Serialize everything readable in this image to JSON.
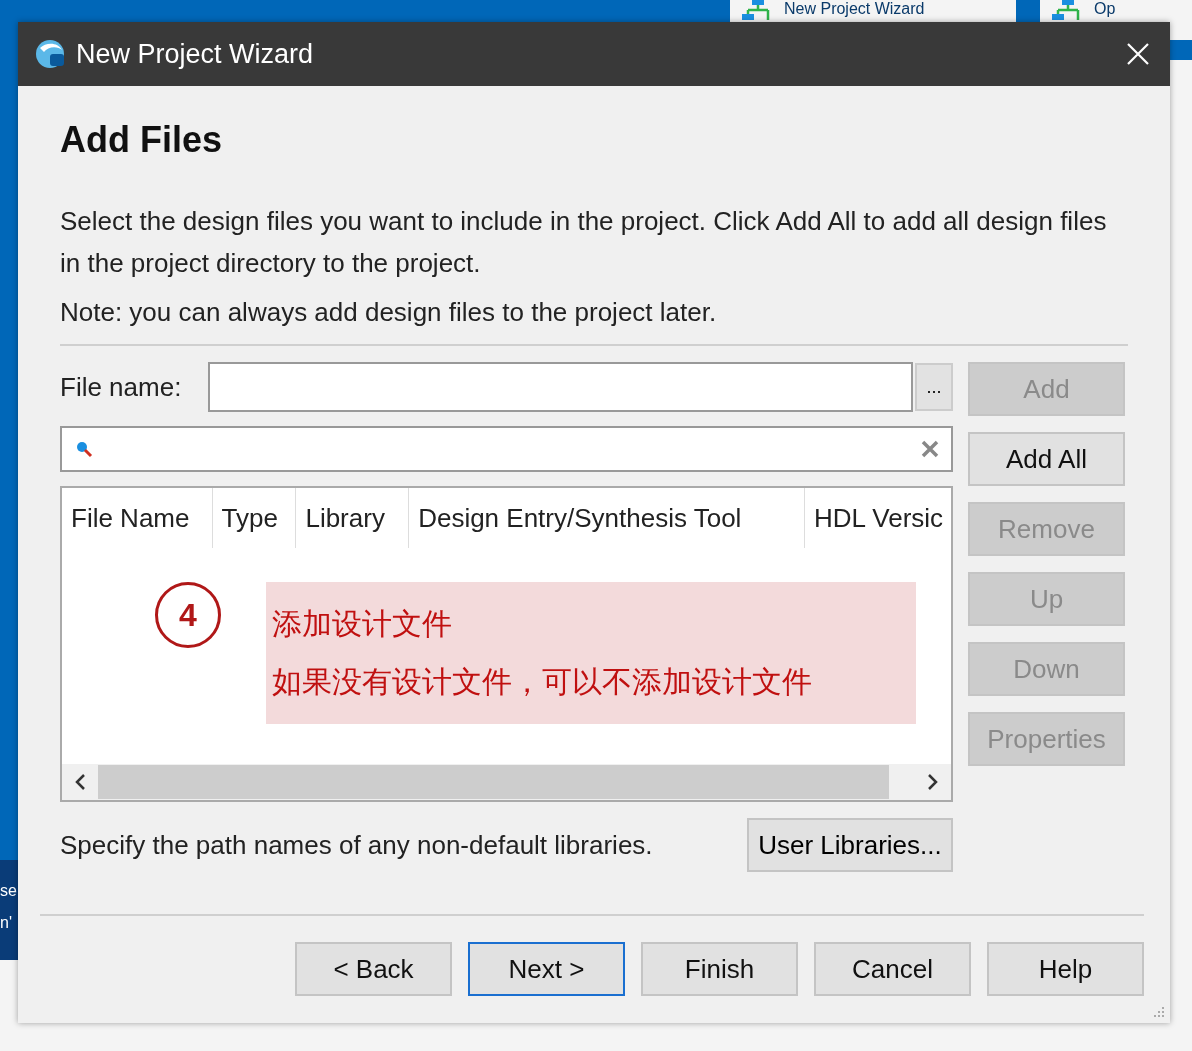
{
  "background": {
    "tabs": [
      {
        "label": "New Project Wizard"
      },
      {
        "label": "Op"
      }
    ],
    "side_texts": [
      "se",
      "n'"
    ]
  },
  "window": {
    "title": "New Project Wizard"
  },
  "heading": "Add Files",
  "description": "Select the design files you want to include in the project. Click Add All to add all design files in the project directory to the project.",
  "note": "Note: you can always add design files to the project later.",
  "file_name": {
    "label": "File name:",
    "browse": "..."
  },
  "table": {
    "columns": [
      "File Name",
      "Type",
      "Library",
      "Design Entry/Synthesis Tool",
      "HDL Versic"
    ]
  },
  "annotation": {
    "number": "4",
    "lines": [
      "添加设计文件",
      "如果没有设计文件，可以不添加设计文件"
    ]
  },
  "side_buttons": [
    {
      "label": "Add",
      "disabled": true
    },
    {
      "label": "Add All",
      "disabled": false
    },
    {
      "label": "Remove",
      "disabled": true
    },
    {
      "label": "Up",
      "disabled": true
    },
    {
      "label": "Down",
      "disabled": true
    },
    {
      "label": "Properties",
      "disabled": true
    }
  ],
  "library_hint": "Specify the path names of any non-default libraries.",
  "user_libraries_button": "User Libraries...",
  "buttons": [
    {
      "label": "< Back",
      "default": false
    },
    {
      "label": "Next >",
      "default": true
    },
    {
      "label": "Finish",
      "default": false
    },
    {
      "label": "Cancel",
      "default": false
    },
    {
      "label": "Help",
      "default": false
    }
  ]
}
